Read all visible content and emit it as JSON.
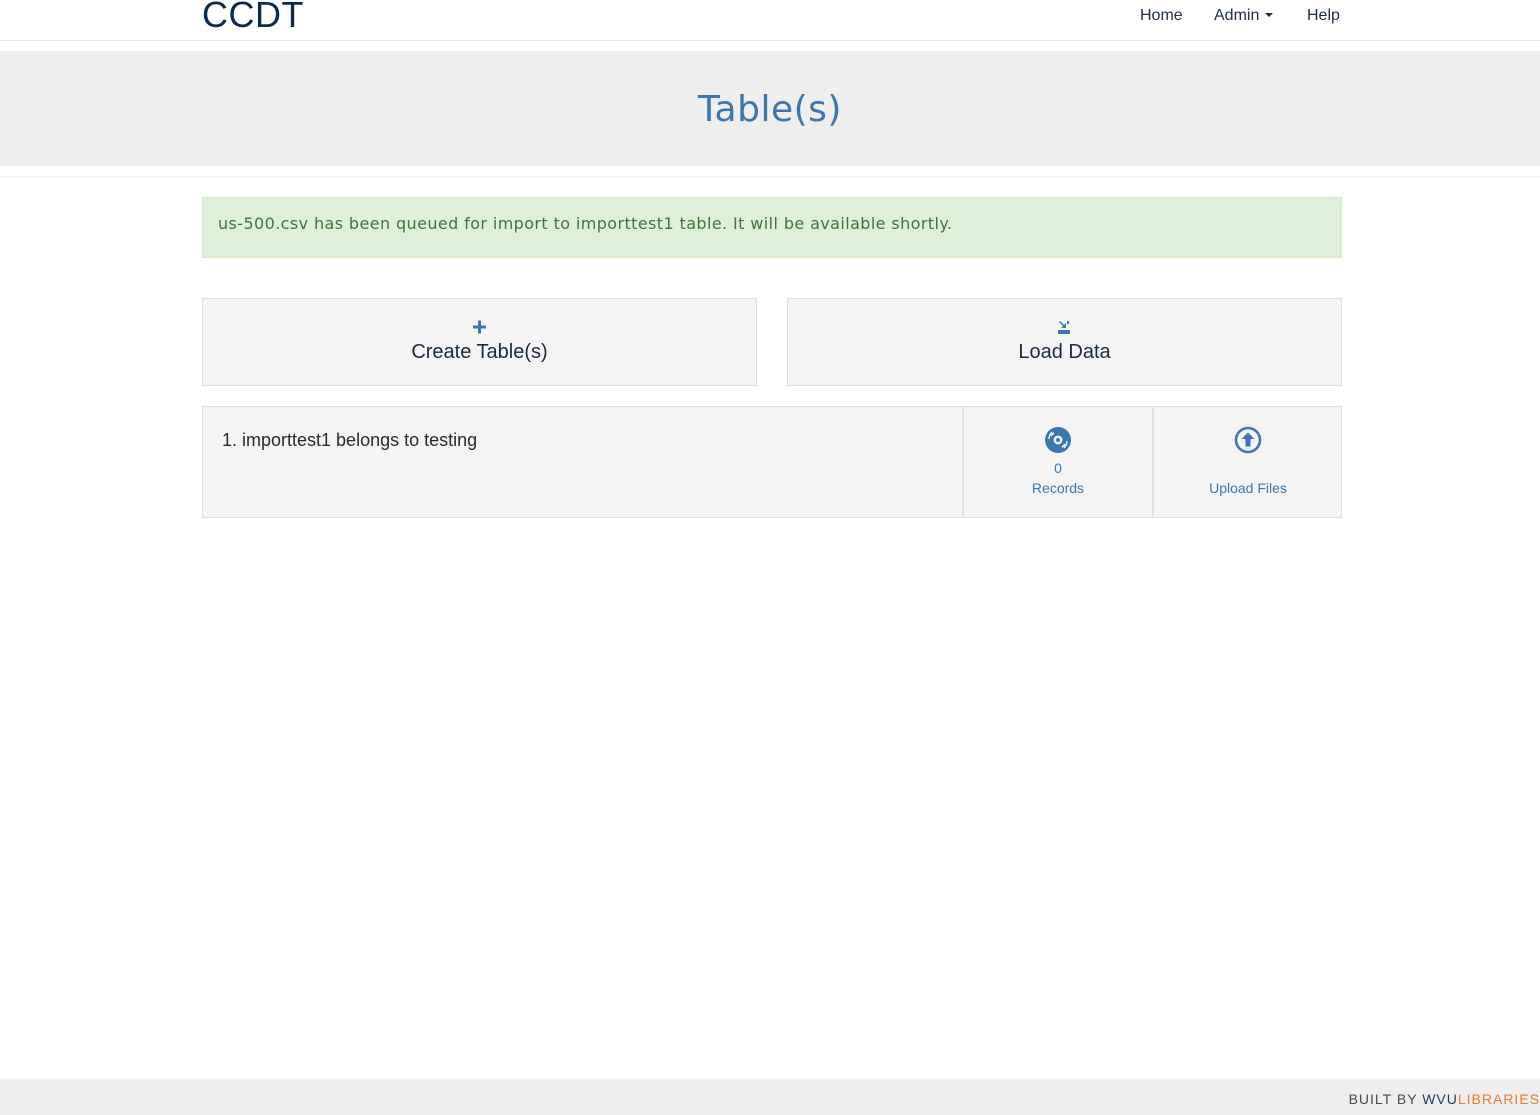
{
  "navbar": {
    "brand": "CCDT",
    "links": [
      {
        "label": "Home"
      },
      {
        "label": "Admin"
      },
      {
        "label": "Help"
      }
    ]
  },
  "header": {
    "title": "Table(s)"
  },
  "alert": {
    "message": "us-500.csv has been queued for import to importtest1 table. It will be available shortly."
  },
  "actions": {
    "create": {
      "label": "Create Table(s)",
      "icon": "plus-icon"
    },
    "load": {
      "label": "Load Data",
      "icon": "load-data-icon"
    }
  },
  "tables": [
    {
      "title": "1. importtest1 belongs to testing",
      "records_count": "0",
      "records_label": "Records",
      "records_icon": "records-disc-icon",
      "upload_label": "Upload Files",
      "upload_icon": "upload-circle-icon"
    }
  ],
  "footer": {
    "built_by": "BUILT BY ",
    "wvu": "WVU",
    "libraries": "LIBRARIES"
  },
  "colors": {
    "link_blue": "#3b76ae",
    "alert_bg": "#dff0d8",
    "alert_text": "#3c763d",
    "footer_accent": "#e57d34"
  }
}
